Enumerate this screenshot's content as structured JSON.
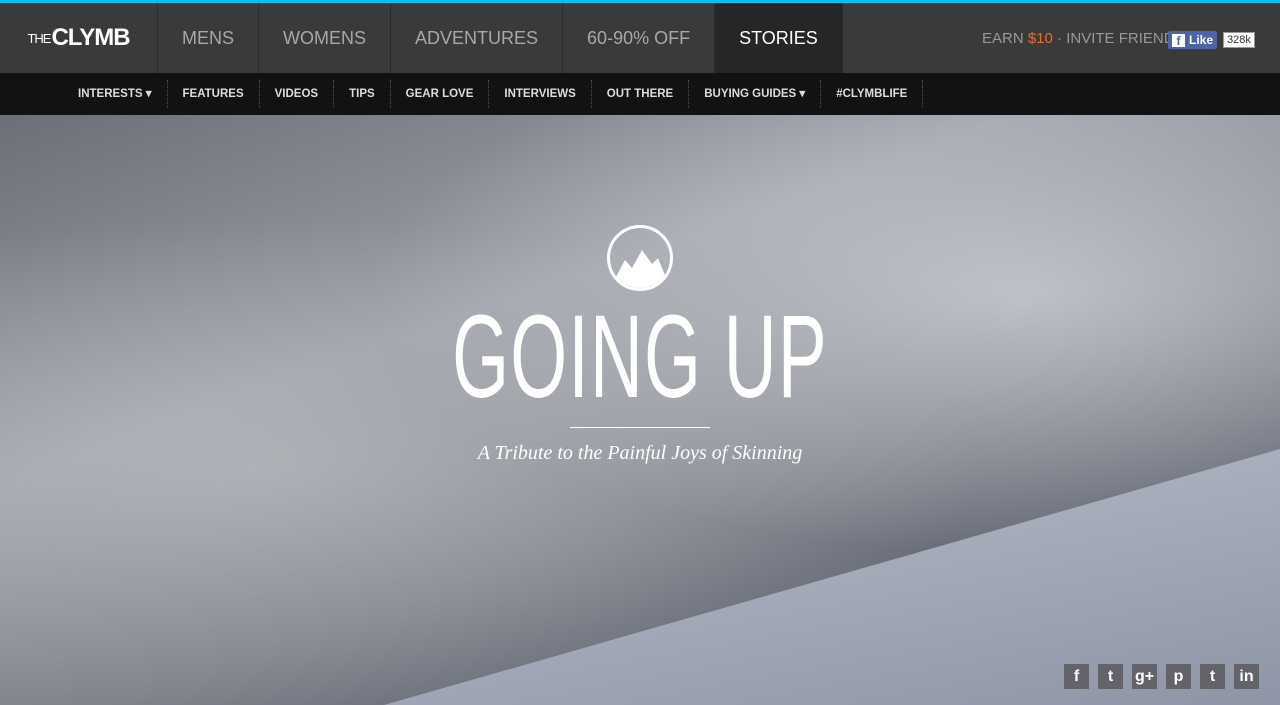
{
  "logo": {
    "the": "THE",
    "clymb": "CLYMB"
  },
  "nav": [
    "MENS",
    "WOMENS",
    "ADVENTURES",
    "60-90% OFF",
    "STORIES"
  ],
  "earn": {
    "prefix": "EARN ",
    "amount": "$10",
    "suffix": " · INVITE FRIENDS"
  },
  "facebook": {
    "like": "Like",
    "count": "328k",
    "f": "f"
  },
  "subnav": [
    "INTERESTS ▾",
    "FEATURES",
    "VIDEOS",
    "TIPS",
    "GEAR LOVE",
    "INTERVIEWS",
    "OUT THERE",
    "BUYING GUIDES ▾",
    "#CLYMBLIFE"
  ],
  "hero": {
    "title": "GOING UP",
    "subtitle": "A Tribute to the Painful Joys of Skinning"
  },
  "social": [
    "f",
    "t",
    "g+",
    "p",
    "t",
    "in"
  ]
}
